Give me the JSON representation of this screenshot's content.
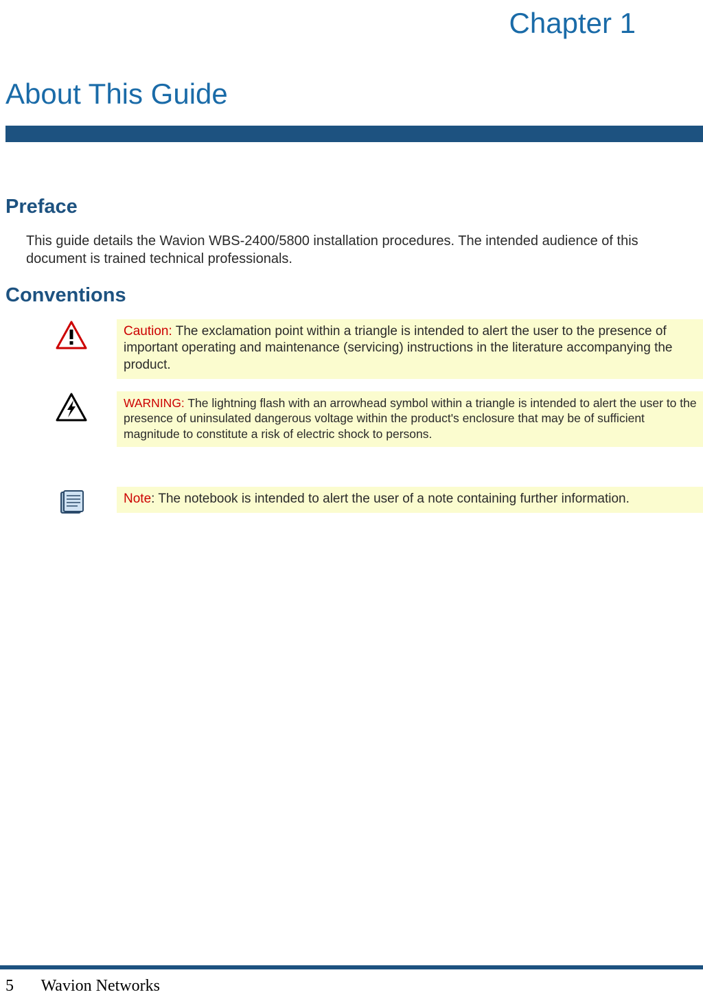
{
  "chapter": "Chapter 1",
  "title": "About This Guide",
  "sections": {
    "preface": {
      "heading": "Preface",
      "body": "This guide details the Wavion WBS-2400/5800 installation procedures. The intended audience of this document is trained technical professionals."
    },
    "conventions": {
      "heading": "Conventions",
      "callouts": {
        "caution": {
          "label": "Caution:",
          "text": "  The exclamation point within a triangle is intended to alert the user to the presence of important operating and maintenance (servicing) instructions in the literature accompanying the product."
        },
        "warning": {
          "label": "WARNING:",
          "text": "  The lightning flash with an arrowhead symbol within a triangle is intended to alert the user to the presence of uninsulated dangerous voltage within the product's enclosure that may be of sufficient magnitude to constitute a risk of electric shock to persons."
        },
        "note": {
          "label": "Note",
          "text": ": The notebook is intended to alert the user of a note containing further information."
        }
      }
    }
  },
  "footer": {
    "page": "5",
    "company": "Wavion Networks"
  }
}
